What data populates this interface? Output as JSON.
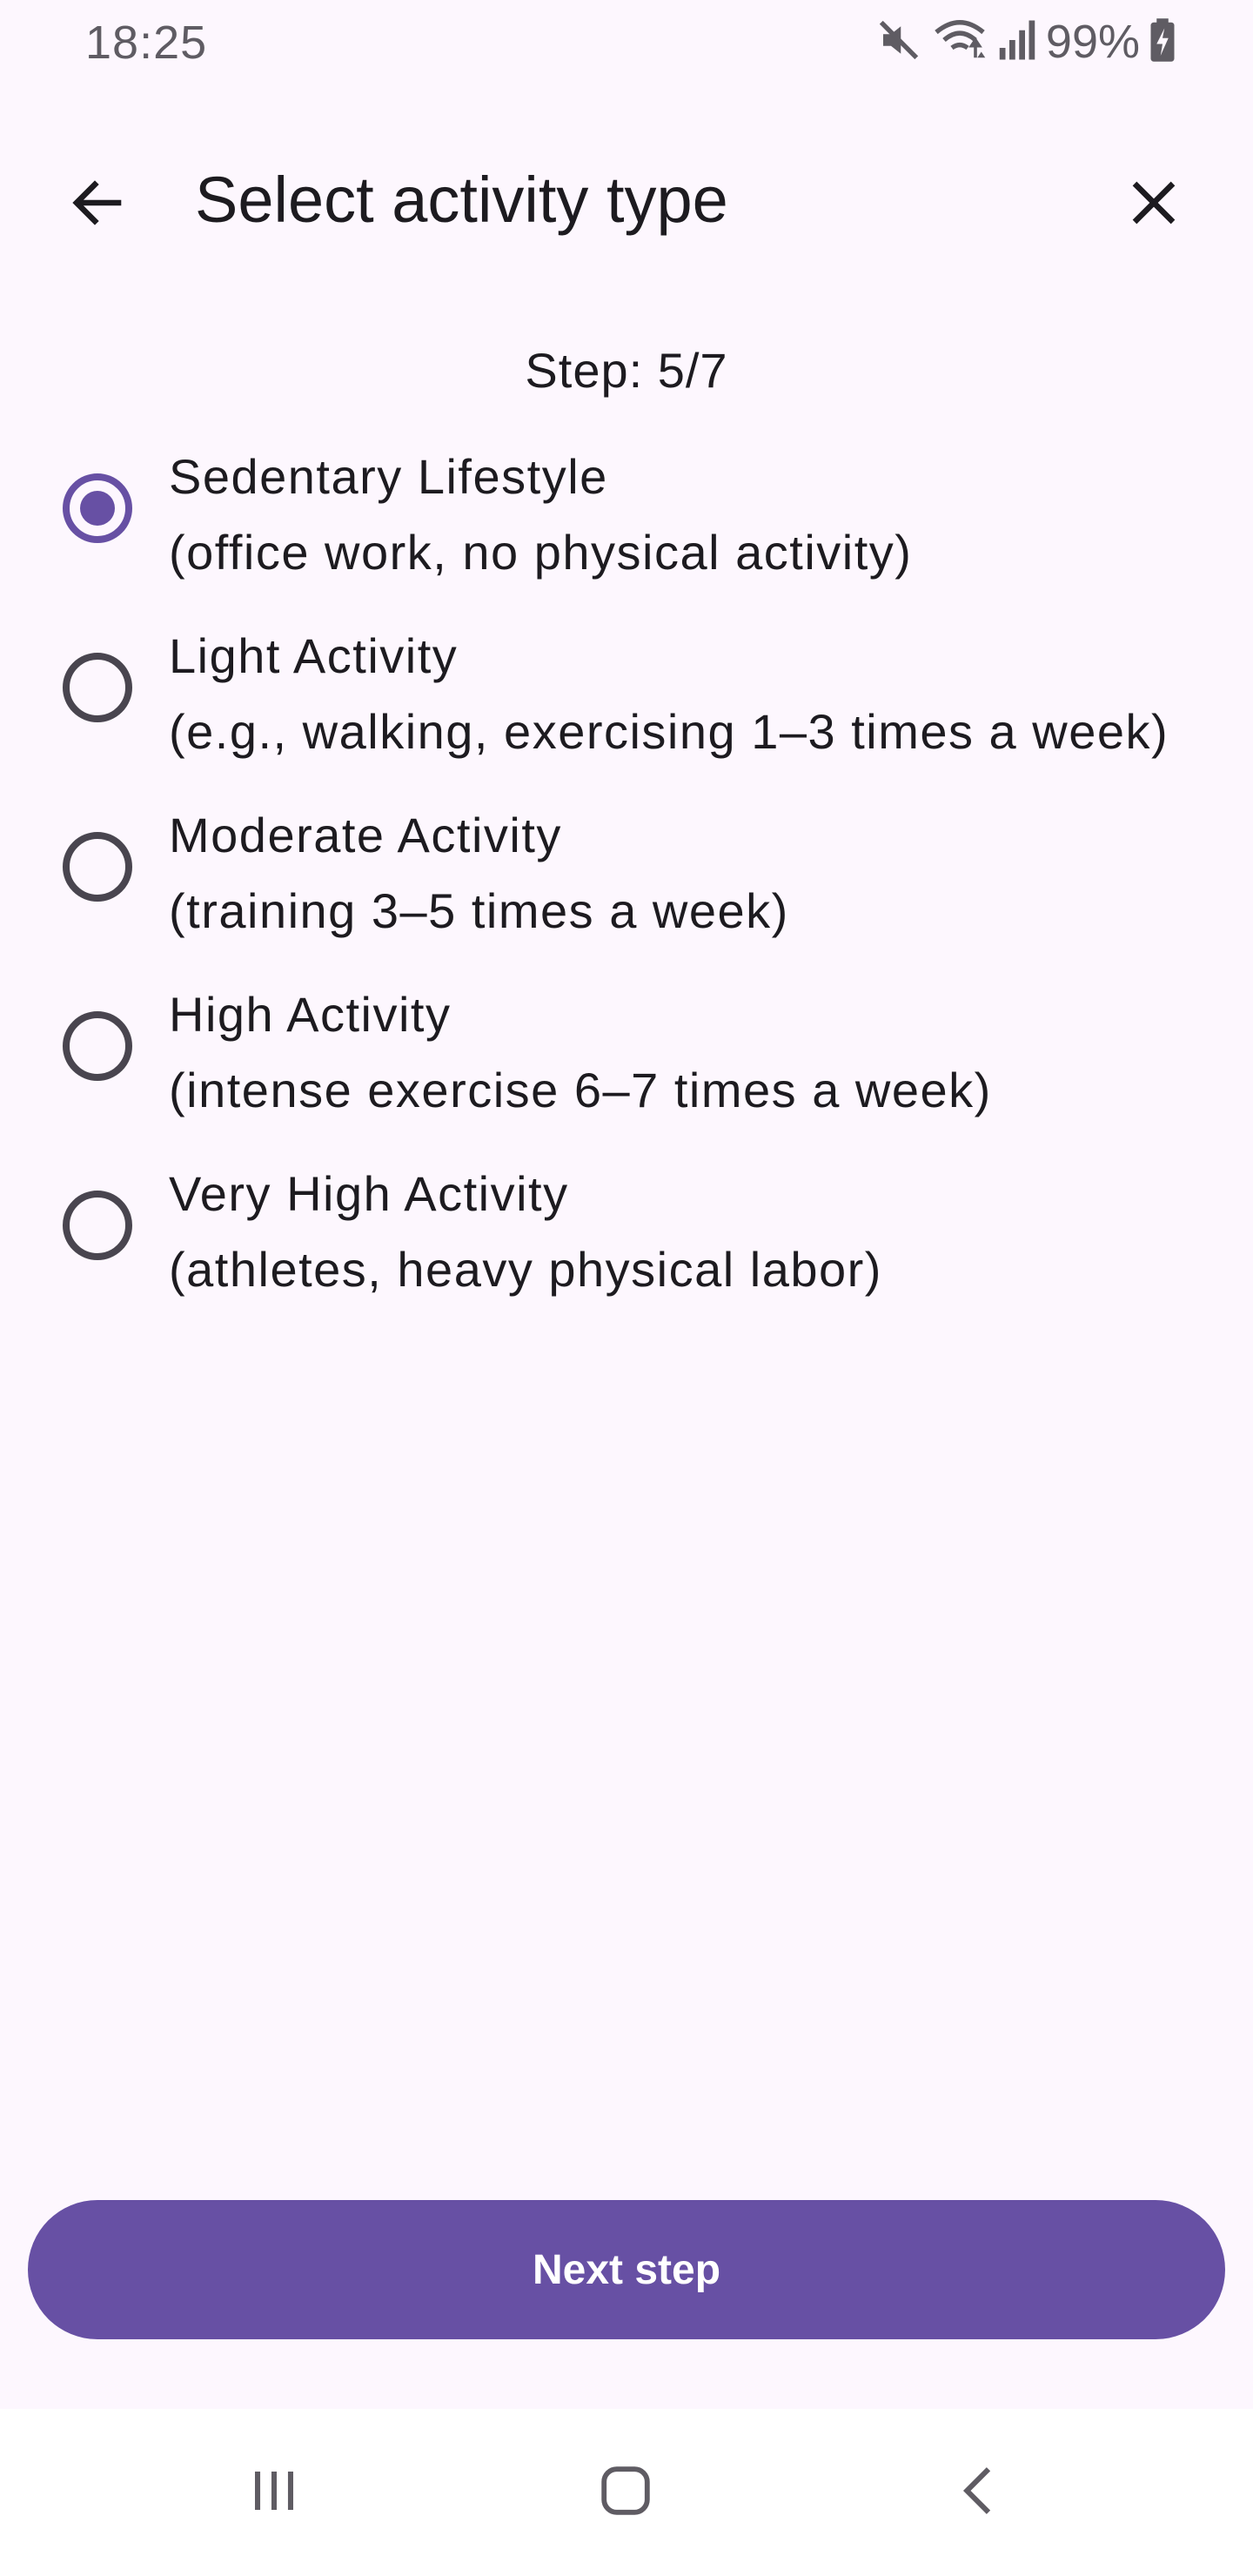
{
  "status_bar": {
    "time": "18:25",
    "battery_level": "99%",
    "icons": [
      "mute-icon",
      "wifi-icon",
      "signal-icon",
      "battery-charging-icon"
    ]
  },
  "app_bar": {
    "title": "Select activity type",
    "back_icon": "arrow-back-icon",
    "close_icon": "close-icon"
  },
  "step": {
    "label": "Step: 5/7"
  },
  "options": [
    {
      "title": "Sedentary Lifestyle",
      "description": "(office work, no physical activity)",
      "selected": true
    },
    {
      "title": "Light Activity",
      "description": "(e.g., walking, exercising 1–3 times a week)",
      "selected": false
    },
    {
      "title": "Moderate Activity",
      "description": "(training 3–5 times a week)",
      "selected": false
    },
    {
      "title": "High Activity",
      "description": "(intense exercise 6–7 times a week)",
      "selected": false
    },
    {
      "title": "Very High Activity",
      "description": "(athletes, heavy physical labor)",
      "selected": false
    }
  ],
  "next_button": {
    "label": "Next step"
  },
  "nav_bar": {
    "icons": [
      "recents-icon",
      "home-icon",
      "back-icon"
    ]
  },
  "colors": {
    "accent": "#6750a4",
    "background": "#fdf7fe",
    "text": "#1d1b20"
  }
}
